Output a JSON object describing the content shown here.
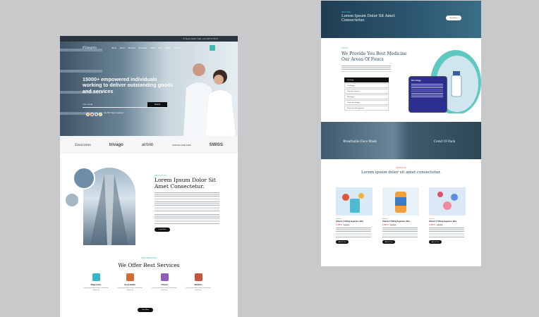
{
  "left": {
    "topbar_text": "✆ Need Help? Call: +12 345 67 89   ✉",
    "logo": "Finopro",
    "nav": [
      "Home",
      "About",
      "Services",
      "Pharmacy",
      "Shop",
      "Blog",
      "Pages",
      "Contact"
    ],
    "hero_title": "15000+ empowered individuals working to deliver outstanding goods and services",
    "hero_input_placeholder": "Your email",
    "hero_button": "Submit",
    "hero_small": "Join 10k+ happy customers",
    "brands": [
      "Emirates",
      "trivago",
      "airbnb",
      "TURKISH AIRLINES",
      "SWISS"
    ],
    "about_label": "ABOUT US",
    "about_heading": "Lorem Ipsum Dolor Sit Amet Consectetur.",
    "about_button": "Learn More",
    "services_label": "OUR SERVICES",
    "services_heading": "We Offer Best Services",
    "services": [
      {
        "title": "Diagnostics",
        "desc": "Lorem ipsum dolor sit amet, consectetur adipiscing",
        "color": "#37b5c9"
      },
      {
        "title": "Good Health",
        "desc": "Lorem ipsum dolor sit amet, consectetur adipiscing",
        "color": "#d06a39"
      },
      {
        "title": "Clinical",
        "desc": "Lorem ipsum dolor sit amet, consectetur adipiscing",
        "color": "#8c5fb8"
      },
      {
        "title": "Medicine",
        "desc": "Lorem ipsum dolor sit amet, consectetur adipiscing",
        "color": "#c0563e"
      }
    ],
    "services_button": "View More"
  },
  "right": {
    "hero_label": "WELCOME",
    "hero_title": "Lorem Ipsum Dolor Sit Amet Consectetur.",
    "hero_button": "Read More",
    "focus_label": "FOCUS",
    "focus_heading": "We Provide You Best Medicine Our Areas Of Foucs",
    "accordion": [
      "Oncology",
      "Cardiology",
      "Infectious Disease",
      "Neurology",
      "Gastro Enterology",
      "Pulmonary Management"
    ],
    "card_title": "Oncology",
    "mid_left": "Breathable Face Mask",
    "mid_right": "Covid 19 Pack",
    "products_label": "PRODUCTS",
    "products_heading": "Lorem ipsum dolor sit amet consectetur.",
    "products": [
      {
        "cat": "Medicine",
        "name": "Vitamin C 500mg Sugarless Tabs",
        "price": "1,500 $",
        "old": "1,800 $",
        "bg": "#d9e9f6"
      },
      {
        "cat": "Medicine",
        "name": "Vitamin C 500mg Sugarless Tabs",
        "price": "2,500 $",
        "old": "2,800 $",
        "bg": "#e8f1f8"
      },
      {
        "cat": "Medicine",
        "name": "Vitamin C 500mg Sugarless Tabs",
        "price": "1,500 $",
        "old": "1,800 $",
        "bg": "#dde8f7"
      }
    ],
    "product_button": "Add to Cart"
  }
}
